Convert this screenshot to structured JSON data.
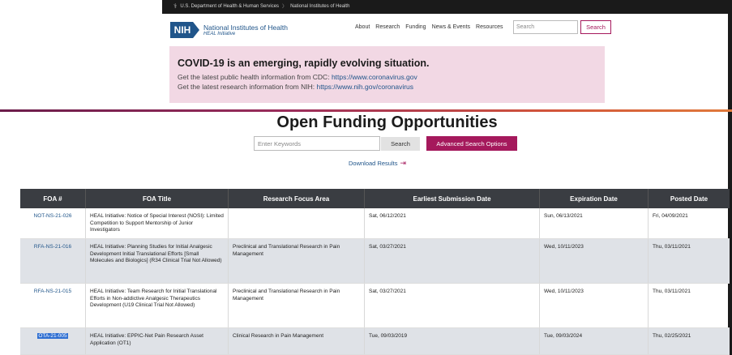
{
  "gov_bar": {
    "hhs": "U.S. Department of Health & Human Services",
    "nih": "National Institutes of Health"
  },
  "header": {
    "logo_mark": "NIH",
    "org_name": "National Institutes of Health",
    "initiative": "HEAL Initiative",
    "nav": [
      "About",
      "Research",
      "Funding",
      "News & Events",
      "Resources"
    ],
    "search_placeholder": "Search",
    "search_button": "Search"
  },
  "covid_banner": {
    "heading": "COVID-19 is an emerging, rapidly evolving situation.",
    "line1_prefix": "Get the latest public health information from CDC:",
    "line1_link": "https://www.coronavirus.gov",
    "line2_prefix": "Get the latest research information from NIH:",
    "line2_link": "https://www.nih.gov/coronavirus"
  },
  "page": {
    "title": "Open Funding Opportunities",
    "keyword_placeholder": "Enter Keywords",
    "search_button": "Search",
    "advanced_button": "Advanced Search Options",
    "download_link": "Download Results"
  },
  "table": {
    "headers": [
      "FOA #",
      "FOA Title",
      "Research Focus Area",
      "Earliest Submission Date",
      "Expiration Date",
      "Posted Date"
    ],
    "rows": [
      {
        "foa": "NOT-NS-21-026",
        "title": "HEAL Initiative: Notice of Special Interest (NOSI): Limited Competition to Support Mentorship of Junior Investigators",
        "focus": "",
        "earliest": "Sat, 06/12/2021",
        "expiration": "Sun, 06/13/2021",
        "posted": "Fri, 04/09/2021"
      },
      {
        "foa": "RFA-NS-21-016",
        "title": "HEAL Initiative: Planning Studies for Initial Analgesic Development Initial Translational Efforts [Small Molecules and Biologics] (R34 Clinical Trial Not Allowed)",
        "focus": "Preclinical and Translational Research in Pain Management",
        "earliest": "Sat, 03/27/2021",
        "expiration": "Wed, 10/11/2023",
        "posted": "Thu, 03/11/2021"
      },
      {
        "foa": "RFA-NS-21-015",
        "title": "HEAL Initiative: Team Research for Initial Translational Efforts in Non-addictive Analgesic Therapeutics Development (U19 Clinical Trial Not Allowed)",
        "focus": "Preclinical and Translational Research in Pain Management",
        "earliest": "Sat, 03/27/2021",
        "expiration": "Wed, 10/11/2023",
        "posted": "Thu, 03/11/2021"
      },
      {
        "foa": "OTA-21-005",
        "title": "HEAL Initiative: EPPIC-Net Pain Research Asset Application (OT1)",
        "focus": "Clinical Research in Pain Management",
        "earliest": "Tue, 09/03/2019",
        "expiration": "Tue, 09/03/2024",
        "posted": "Thu, 02/25/2021"
      }
    ]
  },
  "colors": {
    "brand_blue": "#20558a",
    "accent_magenta": "#a5195c",
    "banner_pink": "#f2d8e4",
    "table_header": "#3a3d42"
  }
}
